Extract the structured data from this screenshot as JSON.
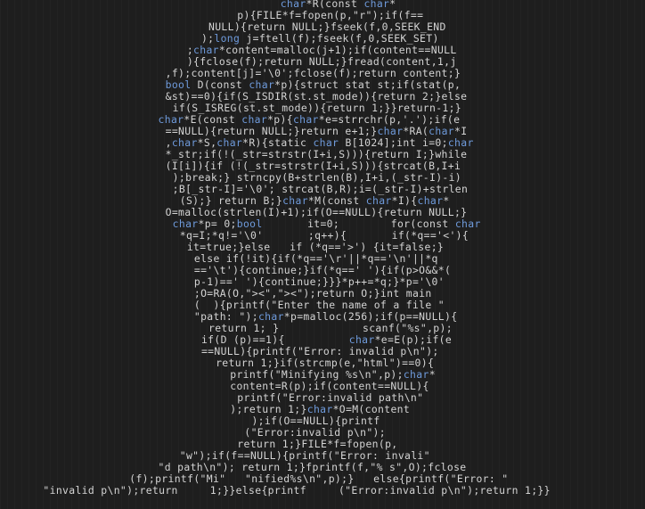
{
  "editor": {
    "lines": [
      {
        "indent": 39,
        "segments": [
          {
            "t": "char",
            "c": "k"
          },
          {
            "t": "*R(const ",
            "c": "p"
          },
          {
            "t": "char",
            "c": "k"
          },
          {
            "t": "*",
            "c": "p"
          }
        ]
      },
      {
        "indent": 33,
        "segments": [
          {
            "t": "p){FILE*f=fopen(p,\"r\");if(f==",
            "c": "p"
          }
        ]
      },
      {
        "indent": 29,
        "segments": [
          {
            "t": "NULL){return NULL;}fseek(f,0,SEEK_END",
            "c": "p"
          }
        ]
      },
      {
        "indent": 28,
        "segments": [
          {
            "t": ");",
            "c": "p"
          },
          {
            "t": "long",
            "c": "k"
          },
          {
            "t": " j=ftell(f);fseek(f,0,SEEK_SET)",
            "c": "p"
          }
        ]
      },
      {
        "indent": 26,
        "segments": [
          {
            "t": ";",
            "c": "p"
          },
          {
            "t": "char",
            "c": "k"
          },
          {
            "t": "*content=malloc(j+1);if(content==NULL",
            "c": "p"
          }
        ]
      },
      {
        "indent": 26,
        "segments": [
          {
            "t": "){fclose(f);return NULL;}fread(content,1,j",
            "c": "p"
          }
        ]
      },
      {
        "indent": 23,
        "segments": [
          {
            "t": ",f);content[j]='\\0';fclose(f);return content;}",
            "c": "p"
          }
        ]
      },
      {
        "indent": 23,
        "segments": [
          {
            "t": "bool",
            "c": "k"
          },
          {
            "t": " D(const ",
            "c": "p"
          },
          {
            "t": "char",
            "c": "k"
          },
          {
            "t": "*p){struct stat st;if(stat(p,",
            "c": "p"
          }
        ]
      },
      {
        "indent": 23,
        "segments": [
          {
            "t": "&st)==0){if(S_ISDIR(st.st_mode)){return 2;}else",
            "c": "p"
          }
        ]
      },
      {
        "indent": 24,
        "segments": [
          {
            "t": "if(S_ISREG(st.st_mode)){return 1;}}return-1;}",
            "c": "p"
          }
        ]
      },
      {
        "indent": 22,
        "segments": [
          {
            "t": "char",
            "c": "k"
          },
          {
            "t": "*E(const ",
            "c": "p"
          },
          {
            "t": "char",
            "c": "k"
          },
          {
            "t": "*p){",
            "c": "p"
          },
          {
            "t": "char",
            "c": "k"
          },
          {
            "t": "*e=strrchr(p,'.');if(e",
            "c": "p"
          }
        ]
      },
      {
        "indent": 23,
        "segments": [
          {
            "t": "==NULL){return NULL;}return e+1;}",
            "c": "p"
          },
          {
            "t": "char",
            "c": "k"
          },
          {
            "t": "*RA(",
            "c": "p"
          },
          {
            "t": "char",
            "c": "k"
          },
          {
            "t": "*I",
            "c": "p"
          }
        ]
      },
      {
        "indent": 23,
        "segments": [
          {
            "t": ",",
            "c": "p"
          },
          {
            "t": "char",
            "c": "k"
          },
          {
            "t": "*S,",
            "c": "p"
          },
          {
            "t": "char",
            "c": "k"
          },
          {
            "t": "*R){static ",
            "c": "p"
          },
          {
            "t": "char",
            "c": "k"
          },
          {
            "t": " B[1024];int i=0;",
            "c": "p"
          },
          {
            "t": "char",
            "c": "k"
          }
        ]
      },
      {
        "indent": 23,
        "segments": [
          {
            "t": "*_str;if(!(_str=strstr(I+i,S))){return I;}while",
            "c": "p"
          }
        ]
      },
      {
        "indent": 23,
        "segments": [
          {
            "t": "(I[i]){if (!(_str=strstr(I+i,S))){strcat(B,I+i",
            "c": "p"
          }
        ]
      },
      {
        "indent": 24,
        "segments": [
          {
            "t": ");break;} strncpy(B+strlen(B),I+i,(_str-I)-i)",
            "c": "p"
          }
        ]
      },
      {
        "indent": 24,
        "segments": [
          {
            "t": ";B[_str-I]='\\0'; strcat(B,R);i=(_str-I)+strlen",
            "c": "p"
          }
        ]
      },
      {
        "indent": 25,
        "segments": [
          {
            "t": "(S);} return B;}",
            "c": "p"
          },
          {
            "t": "char",
            "c": "k"
          },
          {
            "t": "*M(const ",
            "c": "p"
          },
          {
            "t": "char",
            "c": "k"
          },
          {
            "t": "*I){",
            "c": "p"
          },
          {
            "t": "char",
            "c": "k"
          },
          {
            "t": "*",
            "c": "p"
          }
        ]
      },
      {
        "indent": 23,
        "segments": [
          {
            "t": "O=malloc(strlen(I)+1);if(O==NULL){return NULL;}",
            "c": "p"
          }
        ]
      },
      {
        "indent": 24,
        "segments": [
          {
            "t": "char",
            "c": "k"
          },
          {
            "t": "*p= 0;",
            "c": "p"
          },
          {
            "t": "bool",
            "c": "k"
          },
          {
            "t": "       it=0;        for(const ",
            "c": "p"
          },
          {
            "t": "char",
            "c": "k"
          }
        ]
      },
      {
        "indent": 25,
        "segments": [
          {
            "t": "*q=I;*q!='\\0'       ;q++){       if(*q=='<'){",
            "c": "p"
          }
        ]
      },
      {
        "indent": 26,
        "segments": [
          {
            "t": "it=true;}else   if (*q=='>') {it=false;}",
            "c": "p"
          }
        ]
      },
      {
        "indent": 27,
        "segments": [
          {
            "t": "else if(!it){if(*q=='\\r'||*q=='\\n'||*q",
            "c": "p"
          }
        ]
      },
      {
        "indent": 27,
        "segments": [
          {
            "t": "=='\\t'){continue;}if(*q==' '){if(p>O&&*(",
            "c": "p"
          }
        ]
      },
      {
        "indent": 27,
        "segments": [
          {
            "t": "p-1)==' '){continue;}}}*p++=*q;}*p='\\0'",
            "c": "p"
          }
        ]
      },
      {
        "indent": 27,
        "segments": [
          {
            "t": ";O=RA(O,\"><\",\"><\");return O;}int main",
            "c": "p"
          }
        ]
      },
      {
        "indent": 27,
        "segments": [
          {
            "t": "(  ){printf(\"Enter the name of a file \"",
            "c": "p"
          }
        ]
      },
      {
        "indent": 27,
        "segments": [
          {
            "t": "\"path: \");",
            "c": "p"
          },
          {
            "t": "char",
            "c": "k"
          },
          {
            "t": "*p=malloc(256);if(p==NULL){",
            "c": "p"
          }
        ]
      },
      {
        "indent": 29,
        "segments": [
          {
            "t": "return 1; }             scanf(\"%s\",p);",
            "c": "p"
          }
        ]
      },
      {
        "indent": 28,
        "segments": [
          {
            "t": "if(D (p)==1){          ",
            "c": "p"
          },
          {
            "t": "char",
            "c": "k"
          },
          {
            "t": "*e=E(p);if(e",
            "c": "p"
          }
        ]
      },
      {
        "indent": 28,
        "segments": [
          {
            "t": "==NULL){printf(\"Error: invalid p\\n\");",
            "c": "p"
          }
        ]
      },
      {
        "indent": 30,
        "segments": [
          {
            "t": "return 1;}if(strcmp(e,\"html\")==0){",
            "c": "p"
          }
        ]
      },
      {
        "indent": 32,
        "segments": [
          {
            "t": "printf(\"Minifying %s\\n\",p);",
            "c": "p"
          },
          {
            "t": "char",
            "c": "k"
          },
          {
            "t": "*",
            "c": "p"
          }
        ]
      },
      {
        "indent": 32,
        "segments": [
          {
            "t": "content=R(p);if(content==NULL){",
            "c": "p"
          }
        ]
      },
      {
        "indent": 33,
        "segments": [
          {
            "t": "printf(\"Error:invalid path\\n\"",
            "c": "p"
          }
        ]
      },
      {
        "indent": 32,
        "segments": [
          {
            "t": ");return 1;}",
            "c": "p"
          },
          {
            "t": "char",
            "c": "k"
          },
          {
            "t": "*O=M(content",
            "c": "p"
          }
        ]
      },
      {
        "indent": 35,
        "segments": [
          {
            "t": ");if(O==NULL){printf",
            "c": "p"
          }
        ]
      },
      {
        "indent": 34,
        "segments": [
          {
            "t": "(\"Error:invalid p\\n\");",
            "c": "p"
          }
        ]
      },
      {
        "indent": 33,
        "segments": [
          {
            "t": "return 1;}FILE*f=fopen(p,",
            "c": "p"
          }
        ]
      },
      {
        "indent": 25,
        "segments": [
          {
            "t": "\"w\");if(f==NULL){printf(\"Error: invali\"",
            "c": "p"
          }
        ]
      },
      {
        "indent": 22,
        "segments": [
          {
            "t": "\"d path\\n\"); return 1;}fprintf(f,\"% s\",O);fclose",
            "c": "p"
          }
        ]
      },
      {
        "indent": 18,
        "segments": [
          {
            "t": "(f);printf(\"Mi\"   \"nified%s\\n\",p);}   else{printf(\"Error: \"",
            "c": "p"
          }
        ]
      },
      {
        "indent": 6,
        "segments": [
          {
            "t": "\"invalid p\\n\");return     1;}}else{printf     (\"Error:invalid p\\n\");return 1;}}",
            "c": "p"
          }
        ]
      }
    ]
  }
}
